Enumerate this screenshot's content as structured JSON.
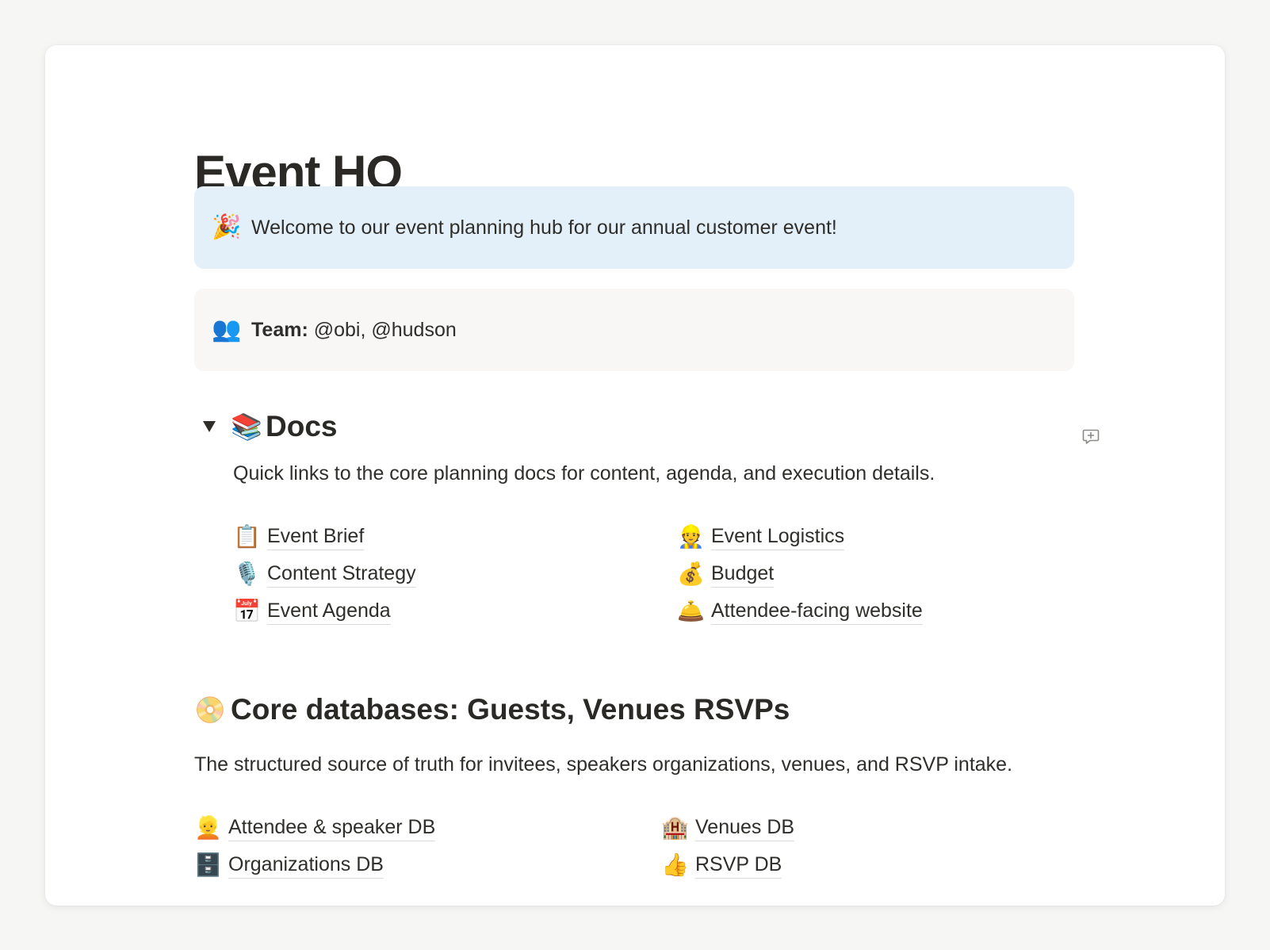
{
  "page": {
    "title": "Event HQ"
  },
  "welcome_callout": {
    "icon": "party-popper-icon",
    "emoji": "🎉",
    "text": "Welcome to our event planning hub for our annual customer event!",
    "background": "#e4f0f9"
  },
  "team_callout": {
    "icon": "two-people-icon",
    "emoji": "👥",
    "label": "Team:",
    "members": " @obi, @hudson",
    "background": "#f8f7f5"
  },
  "docs_section": {
    "icon": "books-icon",
    "emoji": "📚",
    "heading": "Docs",
    "expanded": true,
    "description": "Quick links to the core planning docs for content, agenda, and execution details.",
    "links": [
      {
        "label": "Event Brief",
        "icon": "clipboard-icon",
        "emoji": "📋"
      },
      {
        "label": "Event Logistics",
        "icon": "construction-worker-icon",
        "emoji": "👷"
      },
      {
        "label": "Content Strategy",
        "icon": "microphone-icon",
        "emoji": "🎙️"
      },
      {
        "label": "Budget",
        "icon": "money-bag-icon",
        "emoji": "💰"
      },
      {
        "label": "Event Agenda",
        "icon": "calendar-icon",
        "emoji": "📅"
      },
      {
        "label": "Attendee-facing website",
        "icon": "bell-icon",
        "emoji": "🛎️"
      }
    ]
  },
  "databases_section": {
    "icon": "disc-icon",
    "emoji": "📀",
    "heading": "Core databases: Guests, Venues RSVPs",
    "description": "The structured source of truth for invitees, speakers organizations, venues, and RSVP intake.",
    "links": [
      {
        "label": "Attendee & speaker DB",
        "icon": "person-icon",
        "emoji": "👱"
      },
      {
        "label": "Venues DB",
        "icon": "hotel-icon",
        "emoji": "🏨"
      },
      {
        "label": "Organizations DB",
        "icon": "file-cabinet-icon",
        "emoji": "🗄️"
      },
      {
        "label": "RSVP DB",
        "icon": "thumbs-up-icon",
        "emoji": "👍"
      }
    ]
  }
}
